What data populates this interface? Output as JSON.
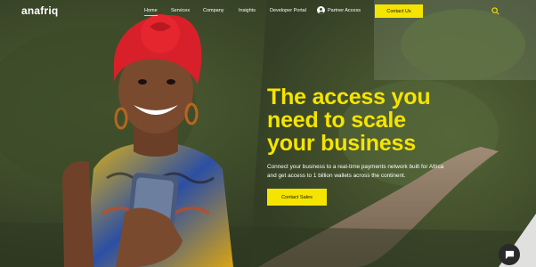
{
  "brand": {
    "logo_text": "anafriq"
  },
  "nav": {
    "items": [
      {
        "label": "Home",
        "active": true
      },
      {
        "label": "Services",
        "active": false
      },
      {
        "label": "Company",
        "active": false
      },
      {
        "label": "Insights",
        "active": false
      },
      {
        "label": "Developer Portal",
        "active": false
      }
    ],
    "partner_label": "Partner Access",
    "contact_label": "Contact Us",
    "search_icon": "search-icon"
  },
  "hero": {
    "headline_lines": [
      "The access you",
      "need to scale",
      "your business"
    ],
    "subtext_lines": [
      "Connect your business to a real-time payments network built for Africa",
      "and get access to 1 billion wallets across the continent."
    ],
    "cta_label": "Contact Sales"
  },
  "colors": {
    "accent": "#f5e400",
    "text": "#ffffff",
    "scarf": "#d8202a"
  },
  "chat": {
    "icon": "chat-icon"
  }
}
